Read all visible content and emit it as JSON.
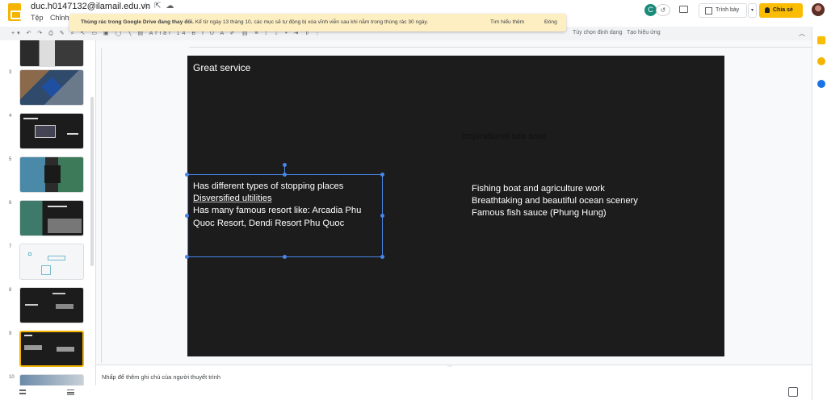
{
  "header": {
    "doc_title": "duc.h0147132@ilamail.edu.vn",
    "title_icons": [
      "star-icon",
      "move-to-folder-icon",
      "cloud-status-icon"
    ],
    "menu": [
      "Tệp",
      "Chỉnh sử"
    ],
    "user_initial": "C",
    "present_label": "Trình bày",
    "share_label": "Chia sẻ"
  },
  "notification": {
    "bold": "Thùng rác trong Google Drive đang thay đổi.",
    "text": " Kể từ ngày 13 tháng 10, các mục sẽ tự động bị xóa vĩnh viễn sau khi nằm trong thùng rác 30 ngày.",
    "learn_more": "Tìm hiểu thêm",
    "close": "Đóng",
    "bg_color": "#feefc3"
  },
  "toolbar": {
    "font": "Arial",
    "font_size": "14",
    "options_label": "Tùy chọn định dạng",
    "animation_label": "Tạo hiệu ứng"
  },
  "filmstrip": {
    "slides": [
      {
        "num": "3"
      },
      {
        "num": "4"
      },
      {
        "num": "5"
      },
      {
        "num": "6"
      },
      {
        "num": "7"
      },
      {
        "num": "8"
      },
      {
        "num": "9"
      },
      {
        "num": "10"
      }
    ],
    "selected": "9",
    "accent": "#f4b400"
  },
  "slide": {
    "title": "Great service",
    "subtitle": "Inspirational sea area",
    "left_lines": [
      "Has different types of stopping places",
      "Disversified ultilities",
      "Has many famous resort like: Arcadia Phu Quoc Resort, Dendi Resort Phu Quoc"
    ],
    "right_lines": [
      "Fishing boat and agriculture work",
      "Breathtaking and beautiful ocean scenery",
      "Famous fish sauce (Phung Hung)"
    ],
    "background": "#1c1c1c"
  },
  "notes": {
    "placeholder": "Nhấp để thêm ghi chú của người thuyết trình"
  }
}
